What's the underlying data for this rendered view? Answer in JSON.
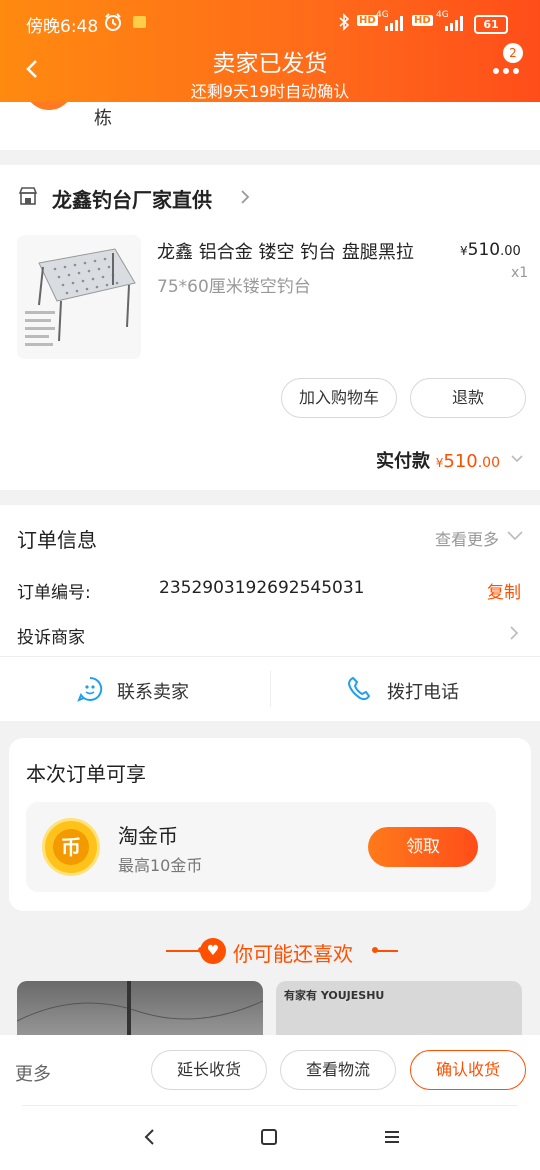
{
  "status_bar": {
    "time": "傍晚6:48",
    "network_1": "4G",
    "network_2": "4G",
    "hd_1": "HD",
    "hd_2": "HD",
    "battery": "61"
  },
  "header": {
    "title": "卖家已发货",
    "subtitle": "还剩9天19时自动确认",
    "more_badge": "2"
  },
  "address": {
    "partial_text": "栋"
  },
  "shop": {
    "name": "龙鑫钓台厂家直供"
  },
  "product": {
    "title": "龙鑫 铝合金 镂空 钓台 盘腿黑拉",
    "spec": "75*60厘米镂空钓台",
    "price_symbol": "¥",
    "price_int": "510",
    "price_dec": ".00",
    "quantity": "x1"
  },
  "product_actions": {
    "add_cart": "加入购物车",
    "refund": "退款"
  },
  "payment": {
    "label": "实付款",
    "symbol": "¥",
    "amount_int": "510",
    "amount_dec": ".00"
  },
  "order_info": {
    "title": "订单信息",
    "view_more": "查看更多",
    "order_no_label": "订单编号:",
    "order_no": "2352903192692545031",
    "copy": "复制",
    "complaint": "投诉商家",
    "contact_seller": "联系卖家",
    "call_phone": "拨打电话"
  },
  "benefit": {
    "title": "本次订单可享",
    "coin_name": "淘金币",
    "coin_desc": "最高10金币",
    "claim": "领取",
    "coin_glyph": "币"
  },
  "recommend": {
    "title": "你可能还喜欢",
    "brand_text": "有家有 YOUJESHU"
  },
  "bottom_bar": {
    "more": "更多",
    "extend": "延长收货",
    "logistics": "查看物流",
    "confirm": "确认收货"
  },
  "colors": {
    "accent": "#ff5000",
    "header_start": "#ff8a10",
    "header_end": "#ff4d1a",
    "icon_blue": "#1ea0f0",
    "coin_yellow": "#ffc21a"
  }
}
